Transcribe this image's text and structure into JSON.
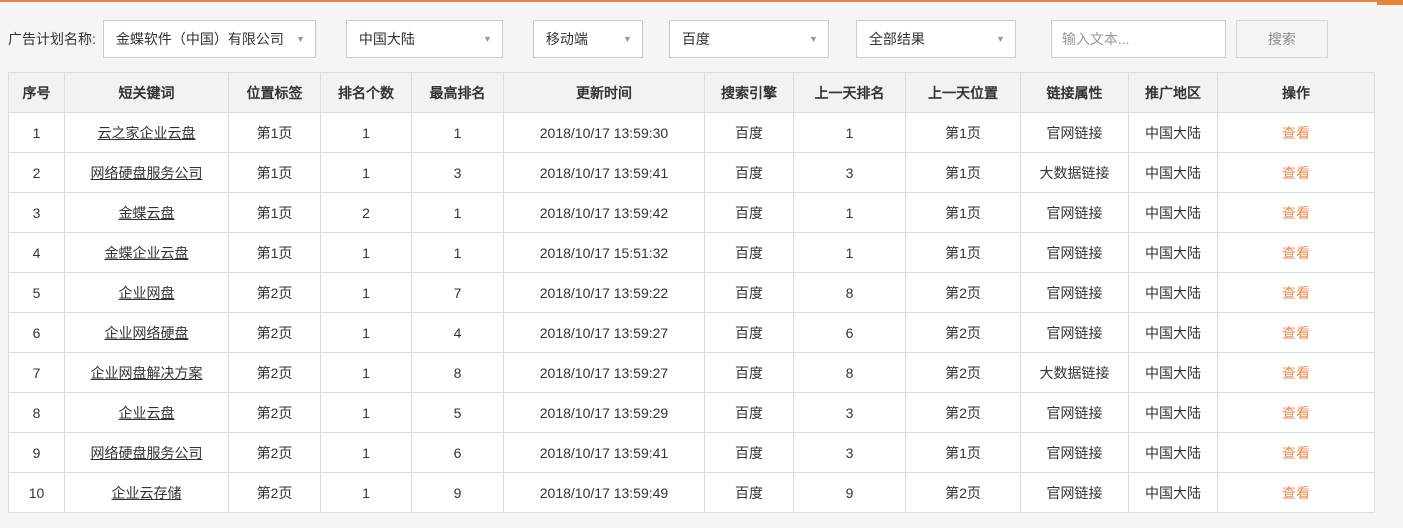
{
  "colors": {
    "accent": "#e8833c",
    "link_orange": "#ee8a4d",
    "header_bg": "#f2f2f2",
    "page_bg": "#f5f5f5",
    "border": "#dcdcdc"
  },
  "filters": {
    "label": "广告计划名称:",
    "dropdowns": [
      {
        "name": "ad-plan",
        "value": "金蝶软件（中国）有限公司"
      },
      {
        "name": "region",
        "value": "中国大陆"
      },
      {
        "name": "device",
        "value": "移动端"
      },
      {
        "name": "engine",
        "value": "百度"
      },
      {
        "name": "result-scope",
        "value": "全部结果"
      }
    ],
    "input_placeholder": "输入文本...",
    "input_value": "",
    "search_button": "搜索"
  },
  "table": {
    "columns": [
      {
        "key": "no",
        "label": "序号"
      },
      {
        "key": "keyword",
        "label": "短关键词"
      },
      {
        "key": "position",
        "label": "位置标签"
      },
      {
        "key": "rank_count",
        "label": "排名个数"
      },
      {
        "key": "best_rank",
        "label": "最高排名"
      },
      {
        "key": "updated",
        "label": "更新时间"
      },
      {
        "key": "engine",
        "label": "搜索引擎"
      },
      {
        "key": "prev_rank",
        "label": "上一天排名"
      },
      {
        "key": "prev_position",
        "label": "上一天位置"
      },
      {
        "key": "link_type",
        "label": "链接属性"
      },
      {
        "key": "region",
        "label": "推广地区"
      },
      {
        "key": "action",
        "label": "操作"
      }
    ],
    "rows": [
      {
        "no": "1",
        "keyword": "云之家企业云盘",
        "position": "第1页",
        "rank_count": "1",
        "best_rank": "1",
        "updated": "2018/10/17 13:59:30",
        "engine": "百度",
        "prev_rank": "1",
        "prev_position": "第1页",
        "link_type": "官网链接",
        "region": "中国大陆",
        "action": "查看"
      },
      {
        "no": "2",
        "keyword": "网络硬盘服务公司",
        "position": "第1页",
        "rank_count": "1",
        "best_rank": "3",
        "updated": "2018/10/17 13:59:41",
        "engine": "百度",
        "prev_rank": "3",
        "prev_position": "第1页",
        "link_type": "大数据链接",
        "region": "中国大陆",
        "action": "查看"
      },
      {
        "no": "3",
        "keyword": "金蝶云盘",
        "position": "第1页",
        "rank_count": "2",
        "best_rank": "1",
        "updated": "2018/10/17 13:59:42",
        "engine": "百度",
        "prev_rank": "1",
        "prev_position": "第1页",
        "link_type": "官网链接",
        "region": "中国大陆",
        "action": "查看"
      },
      {
        "no": "4",
        "keyword": "金蝶企业云盘",
        "position": "第1页",
        "rank_count": "1",
        "best_rank": "1",
        "updated": "2018/10/17 15:51:32",
        "engine": "百度",
        "prev_rank": "1",
        "prev_position": "第1页",
        "link_type": "官网链接",
        "region": "中国大陆",
        "action": "查看"
      },
      {
        "no": "5",
        "keyword": "企业网盘",
        "position": "第2页",
        "rank_count": "1",
        "best_rank": "7",
        "updated": "2018/10/17 13:59:22",
        "engine": "百度",
        "prev_rank": "8",
        "prev_position": "第2页",
        "link_type": "官网链接",
        "region": "中国大陆",
        "action": "查看"
      },
      {
        "no": "6",
        "keyword": "企业网络硬盘",
        "position": "第2页",
        "rank_count": "1",
        "best_rank": "4",
        "updated": "2018/10/17 13:59:27",
        "engine": "百度",
        "prev_rank": "6",
        "prev_position": "第2页",
        "link_type": "官网链接",
        "region": "中国大陆",
        "action": "查看"
      },
      {
        "no": "7",
        "keyword": "企业网盘解决方案",
        "position": "第2页",
        "rank_count": "1",
        "best_rank": "8",
        "updated": "2018/10/17 13:59:27",
        "engine": "百度",
        "prev_rank": "8",
        "prev_position": "第2页",
        "link_type": "大数据链接",
        "region": "中国大陆",
        "action": "查看"
      },
      {
        "no": "8",
        "keyword": "企业云盘",
        "position": "第2页",
        "rank_count": "1",
        "best_rank": "5",
        "updated": "2018/10/17 13:59:29",
        "engine": "百度",
        "prev_rank": "3",
        "prev_position": "第2页",
        "link_type": "官网链接",
        "region": "中国大陆",
        "action": "查看"
      },
      {
        "no": "9",
        "keyword": "网络硬盘服务公司",
        "position": "第2页",
        "rank_count": "1",
        "best_rank": "6",
        "updated": "2018/10/17 13:59:41",
        "engine": "百度",
        "prev_rank": "3",
        "prev_position": "第1页",
        "link_type": "官网链接",
        "region": "中国大陆",
        "action": "查看"
      },
      {
        "no": "10",
        "keyword": "企业云存储",
        "position": "第2页",
        "rank_count": "1",
        "best_rank": "9",
        "updated": "2018/10/17 13:59:49",
        "engine": "百度",
        "prev_rank": "9",
        "prev_position": "第2页",
        "link_type": "官网链接",
        "region": "中国大陆",
        "action": "查看"
      }
    ]
  }
}
